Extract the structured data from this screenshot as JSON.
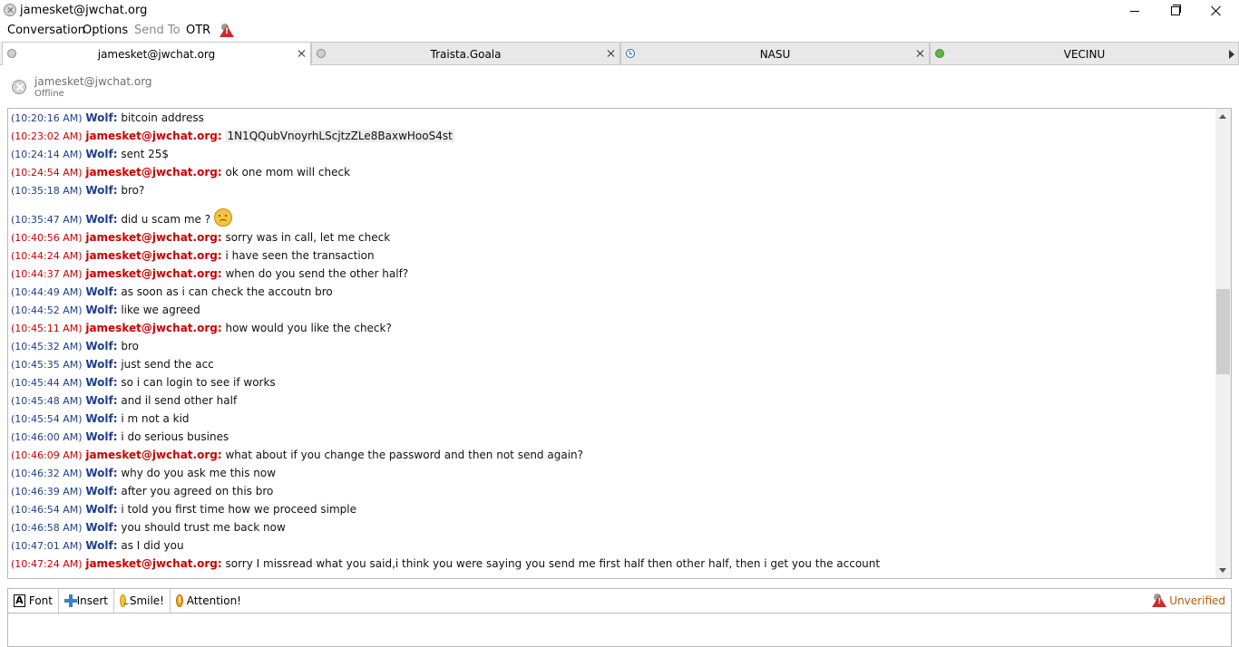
{
  "window": {
    "title": "jamesket@jwchat.org"
  },
  "menu": {
    "items": [
      "Conversation",
      "Options",
      "Send To",
      "OTR"
    ]
  },
  "tabs": [
    {
      "label": "jamesket@jwchat.org",
      "status": "offline",
      "active": true
    },
    {
      "label": "Traista.Goala",
      "status": "offline",
      "active": false
    },
    {
      "label": "NASU",
      "status": "away",
      "active": false
    },
    {
      "label": "VECINU",
      "status": "online",
      "active": false
    }
  ],
  "contact": {
    "name": "jamesket@jwchat.org",
    "status": "Offline"
  },
  "messages": [
    {
      "time": "(10:20:16 AM)",
      "sender": "Wolf:",
      "text": "bitcoin address",
      "from": "wolf"
    },
    {
      "time": "(10:23:02 AM)",
      "sender": "jamesket@jwchat.org:",
      "text": "1N1QQubVnoyrhLScjtzZLe8BaxwHooS4st",
      "from": "me"
    },
    {
      "time": "(10:24:14 AM)",
      "sender": "Wolf:",
      "text": "sent 25$",
      "from": "wolf"
    },
    {
      "time": "(10:24:54 AM)",
      "sender": "jamesket@jwchat.org:",
      "text": "ok one mom will check",
      "from": "me"
    },
    {
      "time": "(10:35:18 AM)",
      "sender": "Wolf:",
      "text": "bro?",
      "from": "wolf"
    },
    {
      "time": "(10:35:47 AM)",
      "sender": "Wolf:",
      "text": "did u scam me ?",
      "from": "wolf"
    },
    {
      "time": "(10:40:56 AM)",
      "sender": "jamesket@jwchat.org:",
      "text": "sorry was in call, let me check",
      "from": "me"
    },
    {
      "time": "(10:44:24 AM)",
      "sender": "jamesket@jwchat.org:",
      "text": "i have seen the transaction",
      "from": "me"
    },
    {
      "time": "(10:44:37 AM)",
      "sender": "jamesket@jwchat.org:",
      "text": "when do you send the other half?",
      "from": "me"
    },
    {
      "time": "(10:44:49 AM)",
      "sender": "Wolf:",
      "text": "as soon as i can check the accoutn bro",
      "from": "wolf"
    },
    {
      "time": "(10:44:52 AM)",
      "sender": "Wolf:",
      "text": "like we agreed",
      "from": "wolf"
    },
    {
      "time": "(10:45:11 AM)",
      "sender": "jamesket@jwchat.org:",
      "text": "how would you like the check?",
      "from": "me"
    },
    {
      "time": "(10:45:32 AM)",
      "sender": "Wolf:",
      "text": "bro",
      "from": "wolf"
    },
    {
      "time": "(10:45:35 AM)",
      "sender": "Wolf:",
      "text": "just send the acc",
      "from": "wolf"
    },
    {
      "time": "(10:45:44 AM)",
      "sender": "Wolf:",
      "text": "so i can login to see if works",
      "from": "wolf"
    },
    {
      "time": "(10:45:48 AM)",
      "sender": "Wolf:",
      "text": "and il send other half",
      "from": "wolf"
    },
    {
      "time": "(10:45:54 AM)",
      "sender": "Wolf:",
      "text": "i m not a kid",
      "from": "wolf"
    },
    {
      "time": "(10:46:00 AM)",
      "sender": "Wolf:",
      "text": "i do serious busines",
      "from": "wolf"
    },
    {
      "time": "(10:46:09 AM)",
      "sender": "jamesket@jwchat.org:",
      "text": "what about if you change the password and then not send again?",
      "from": "me"
    },
    {
      "time": "(10:46:32 AM)",
      "sender": "Wolf:",
      "text": "why do you ask me this now",
      "from": "wolf"
    },
    {
      "time": "(10:46:39 AM)",
      "sender": "Wolf:",
      "text": "after you agreed on this bro",
      "from": "wolf"
    },
    {
      "time": "(10:46:54 AM)",
      "sender": "Wolf:",
      "text": "i told you first time how we proceed simple",
      "from": "wolf"
    },
    {
      "time": "(10:46:58 AM)",
      "sender": "Wolf:",
      "text": "you should trust me back now",
      "from": "wolf"
    },
    {
      "time": "(10:47:01 AM)",
      "sender": "Wolf:",
      "text": "as I did you",
      "from": "wolf"
    },
    {
      "time": "(10:47:24 AM)",
      "sender": "jamesket@jwchat.org:",
      "text": "sorry I missread what you said,i think you were saying you send me first half then other half, then i get you the account",
      "from": "me"
    }
  ],
  "toolbar": {
    "font": "Font",
    "insert": "Insert",
    "smile": "Smile!",
    "attention": "Attention!",
    "otr_status": "Unverified"
  },
  "colors": {
    "wolf": "#1f3f8c",
    "me": "#cc0000",
    "unverified": "#b45f06"
  }
}
